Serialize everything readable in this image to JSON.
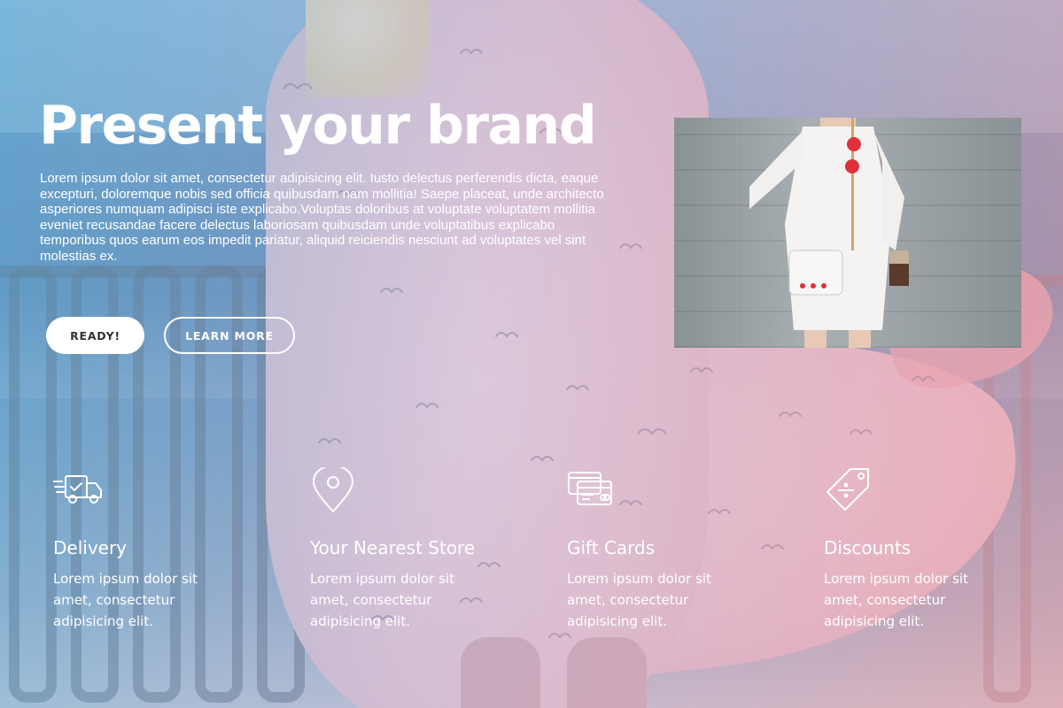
{
  "hero": {
    "title": "Present your brand",
    "text": "Lorem ipsum dolor sit amet, consectetur adipisicing elit. Iusto delectus perferendis dicta, eaque excepturi, doloremque nobis sed officia quibusdam nam mollitia! Saepe placeat, unde architecto asperiores numquam adipisci iste explicabo.Voluptas doloribus at voluptate voluptatem mollitia eveniet recusandae facere delectus laboriosam quibusdam unde voluptatibus explicabo temporibus quos earum eos impedit pariatur, aliquid reiciendis nesciunt ad voluptates vel sint molestias ex.",
    "buttons": {
      "ready": "READY!",
      "learn_more": "LEARN MORE"
    }
  },
  "features": [
    {
      "icon": "delivery-truck-icon",
      "title": "Delivery",
      "text": "Lorem ipsum dolor sit amet, consectetur adipisicing elit."
    },
    {
      "icon": "map-pin-icon",
      "title": "Your Nearest Store",
      "text": "Lorem ipsum dolor sit amet, consectetur adipisicing elit."
    },
    {
      "icon": "gift-cards-icon",
      "title": "Gift Cards",
      "text": "Lorem ipsum dolor sit amet, consectetur adipisicing elit."
    },
    {
      "icon": "price-tag-icon",
      "title": "Discounts",
      "text": "Lorem ipsum dolor sit amet, consectetur adipisicing elit."
    }
  ],
  "colors": {
    "overlay_left": "#78b9e1",
    "overlay_right": "#f5a0aa",
    "text": "#ffffff",
    "button_text": "#333333"
  }
}
